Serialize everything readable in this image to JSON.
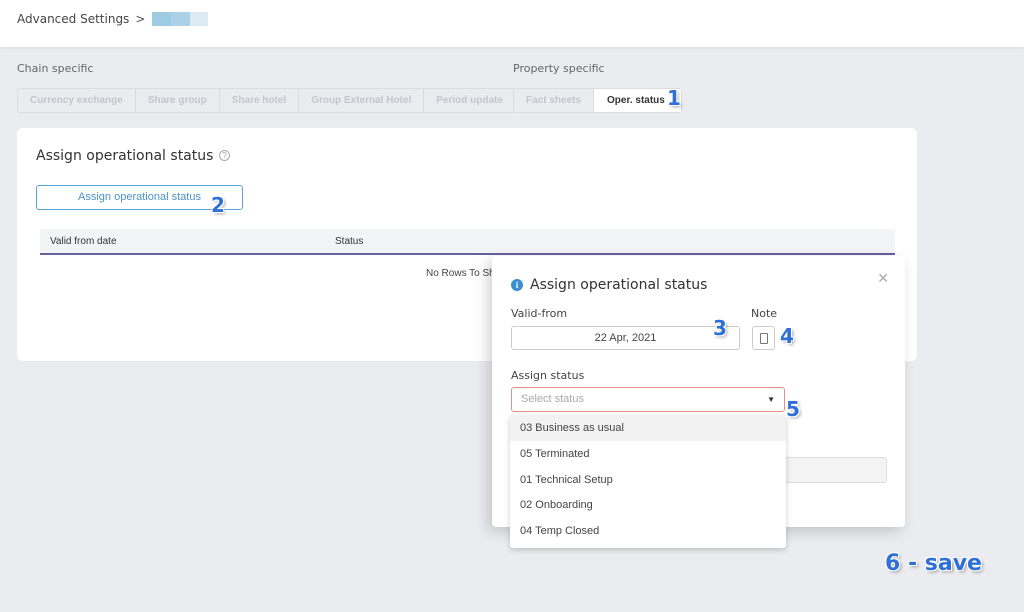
{
  "breadcrumb": {
    "root": "Advanced Settings",
    "separator": ">"
  },
  "chain_specific": {
    "label": "Chain specific",
    "tabs": [
      "Currency exchange",
      "Share group",
      "Share hotel",
      "Group External Hotel",
      "Period update"
    ]
  },
  "property_specific": {
    "label": "Property specific",
    "tabs": [
      "Fact sheets",
      "Oper. status"
    ],
    "active_tab": "Oper. status"
  },
  "card": {
    "title": "Assign operational status",
    "help_icon": "question-circle-icon",
    "assign_button": "Assign operational status",
    "columns": [
      "Valid from date",
      "Status"
    ],
    "empty_text": "No Rows To Show"
  },
  "modal": {
    "title": "Assign operational status",
    "title_icon": "info-circle-icon",
    "close_icon": "close-icon",
    "valid_from_label": "Valid-from",
    "valid_from_value": "22 Apr, 2021",
    "note_label": "Note",
    "note_icon": "document-icon",
    "assign_status_label": "Assign status",
    "select_placeholder": "Select status",
    "caret_icon": "caret-down-icon"
  },
  "status_options": [
    "03 Business as usual",
    "05 Terminated",
    "01 Technical Setup",
    "02 Onboarding",
    "04 Temp Closed"
  ],
  "highlighted_option": "03 Business as usual",
  "annotations": [
    "1",
    "2",
    "3",
    "4",
    "5",
    "6 - save"
  ],
  "colors": {
    "accent": "#4b94c4",
    "error_border": "#e58e8e",
    "annotation": "#2f6fd6",
    "grid_underline": "#6a5fa0",
    "background": "#ebecf0"
  }
}
